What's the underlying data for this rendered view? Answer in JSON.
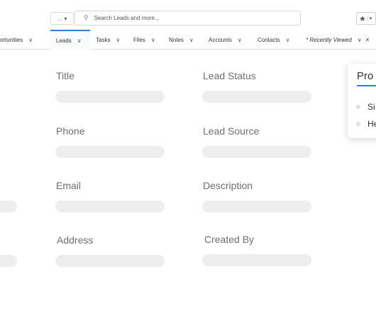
{
  "header": {
    "scope_label": "...",
    "search_placeholder": "Search Leads and more..."
  },
  "nav": {
    "items": [
      {
        "label": "Opportunities",
        "text": "pportunities"
      },
      {
        "label": "Leads"
      },
      {
        "label": "Tasks"
      },
      {
        "label": "Files"
      },
      {
        "label": "Notes"
      },
      {
        "label": "Accounts"
      },
      {
        "label": "Contacts"
      },
      {
        "label": "* Recently Viewed"
      }
    ],
    "active": "Leads"
  },
  "form": {
    "fields": [
      {
        "label": "Title"
      },
      {
        "label": "Lead Status"
      },
      {
        "label": "Phone"
      },
      {
        "label": "Lead Source"
      },
      {
        "label": "Email"
      },
      {
        "label": "Description"
      },
      {
        "label": "Address"
      },
      {
        "label": "Created By"
      }
    ]
  },
  "popover": {
    "title": "Pro",
    "items": [
      {
        "label": "Si"
      },
      {
        "label": "He"
      }
    ]
  },
  "colors": {
    "accent": "#2f7fd6",
    "placeholder_bar": "#eeeeee"
  }
}
